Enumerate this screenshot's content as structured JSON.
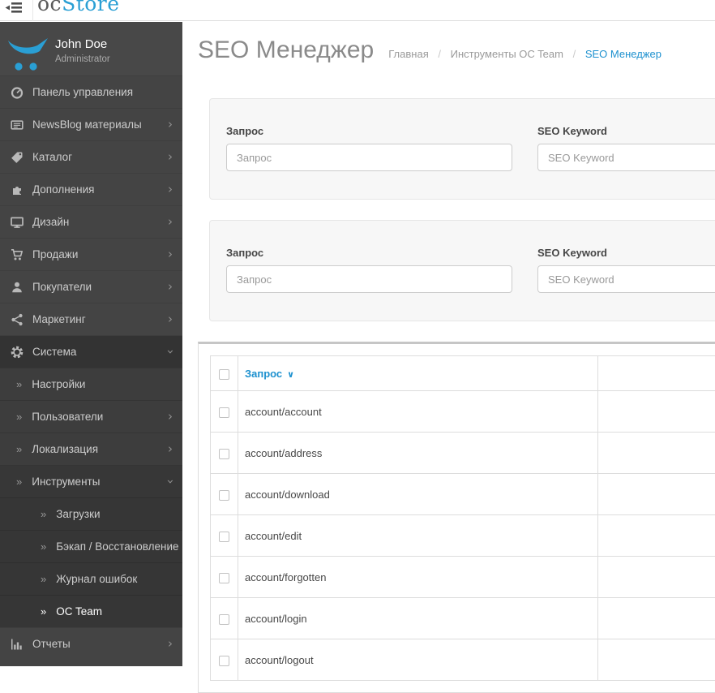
{
  "colors": {
    "accent_link": "#1e91cf",
    "logo_blue": "#2a9fd4",
    "sidebar_bg": "#444444"
  },
  "topbar": {
    "logo": {
      "prefix": "oc",
      "suffix": "Store"
    }
  },
  "profile": {
    "name": "John Doe",
    "role": "Administrator"
  },
  "icons": {
    "chevron_right": "›",
    "sub_item_arrow": "»",
    "sort_caret": "∨"
  },
  "sidebar": {
    "items": [
      {
        "label": "Панель управления"
      },
      {
        "label": "NewsBlog материалы"
      },
      {
        "label": "Каталог"
      },
      {
        "label": "Дополнения"
      },
      {
        "label": "Дизайн"
      },
      {
        "label": "Продажи"
      },
      {
        "label": "Покупатели"
      },
      {
        "label": "Маркетинг"
      },
      {
        "label": "Система",
        "expanded": true
      },
      {
        "label": "Настройки",
        "level": 2
      },
      {
        "label": "Пользователи",
        "level": 2
      },
      {
        "label": "Локализация",
        "level": 2
      },
      {
        "label": "Инструменты",
        "level": 2,
        "expanded": true
      },
      {
        "label": "Загрузки",
        "level": 3
      },
      {
        "label": "Бэкап / Восстановление",
        "level": 3
      },
      {
        "label": "Журнал ошибок",
        "level": 3
      },
      {
        "label": "OC Team",
        "level": 3,
        "active": true
      },
      {
        "label": "Отчеты"
      }
    ]
  },
  "page": {
    "title": "SEO Менеджер",
    "breadcrumb": [
      {
        "label": "Главная"
      },
      {
        "label": "Инструменты OC Team"
      },
      {
        "label": "SEO Менеджер",
        "active": true
      }
    ]
  },
  "filters": {
    "panels": [
      {
        "fields": [
          {
            "label": "Запрос",
            "placeholder": "Запрос",
            "value": ""
          },
          {
            "label": "SEO Keyword",
            "placeholder": "SEO Keyword",
            "value": ""
          }
        ]
      },
      {
        "fields": [
          {
            "label": "Запрос",
            "placeholder": "Запрос",
            "value": ""
          },
          {
            "label": "SEO Keyword",
            "placeholder": "SEO Keyword",
            "value": ""
          }
        ]
      }
    ]
  },
  "table": {
    "columns": [
      {
        "label": "Запрос",
        "sorted": "asc"
      },
      {
        "label": ""
      }
    ],
    "rows": [
      "account/account",
      "account/address",
      "account/download",
      "account/edit",
      "account/forgotten",
      "account/login",
      "account/logout"
    ]
  }
}
